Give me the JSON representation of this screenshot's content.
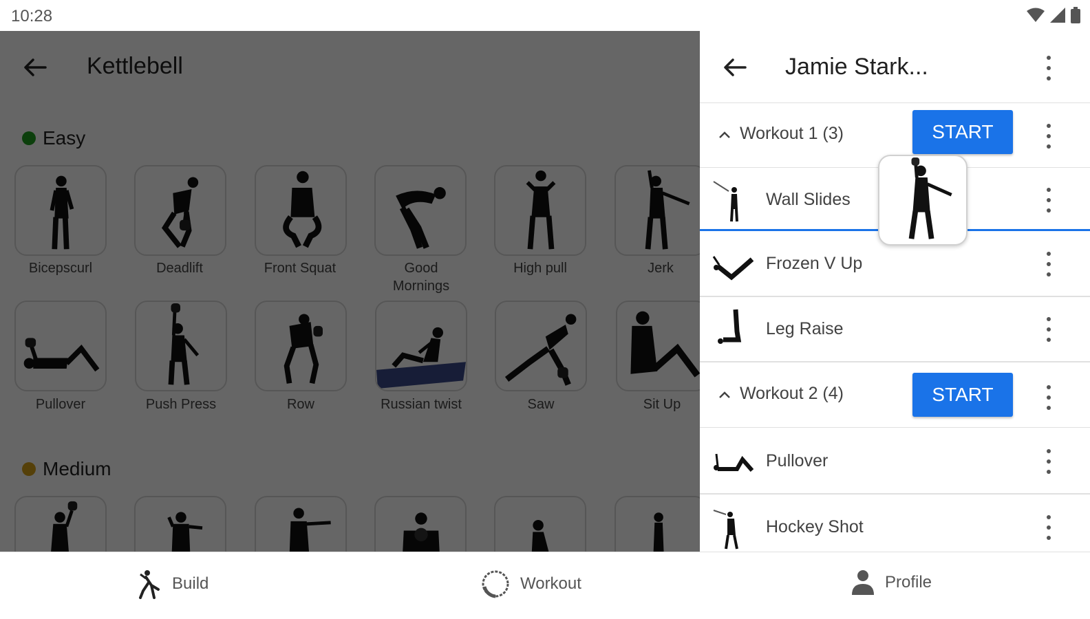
{
  "status_bar": {
    "time": "10:28"
  },
  "left_panel": {
    "title": "Kettlebell",
    "sections": [
      {
        "label": "Easy",
        "color": "#1f9e1f"
      },
      {
        "label": "Medium",
        "color": "#d4a017"
      }
    ],
    "easy_exercises": [
      {
        "label": "Bicepscurl"
      },
      {
        "label": "Deadlift"
      },
      {
        "label": "Front Squat"
      },
      {
        "label": "Good Mornings"
      },
      {
        "label": "High pull"
      },
      {
        "label": "Jerk"
      },
      {
        "label": "Pullover"
      },
      {
        "label": "Push Press"
      },
      {
        "label": "Row"
      },
      {
        "label": "Russian twist"
      },
      {
        "label": "Saw"
      },
      {
        "label": "Sit Up"
      }
    ]
  },
  "right_panel": {
    "title": "Jamie Stark...",
    "workouts": [
      {
        "title": "Workout 1 (3)",
        "start_label": "START",
        "exercises": [
          {
            "name": "Wall Slides"
          },
          {
            "name": "Frozen V Up"
          },
          {
            "name": "Leg Raise"
          }
        ]
      },
      {
        "title": "Workout 2 (4)",
        "start_label": "START",
        "exercises": [
          {
            "name": "Pullover"
          },
          {
            "name": "Hockey Shot"
          }
        ]
      }
    ]
  },
  "bottom_nav": {
    "items": [
      {
        "label": "Build",
        "icon": "build-icon"
      },
      {
        "label": "Workout",
        "icon": "workout-icon"
      },
      {
        "label": "Profile",
        "icon": "profile-icon"
      }
    ]
  },
  "colors": {
    "accent": "#1a73e8",
    "scrim": "rgba(0,0,0,0.6)"
  }
}
